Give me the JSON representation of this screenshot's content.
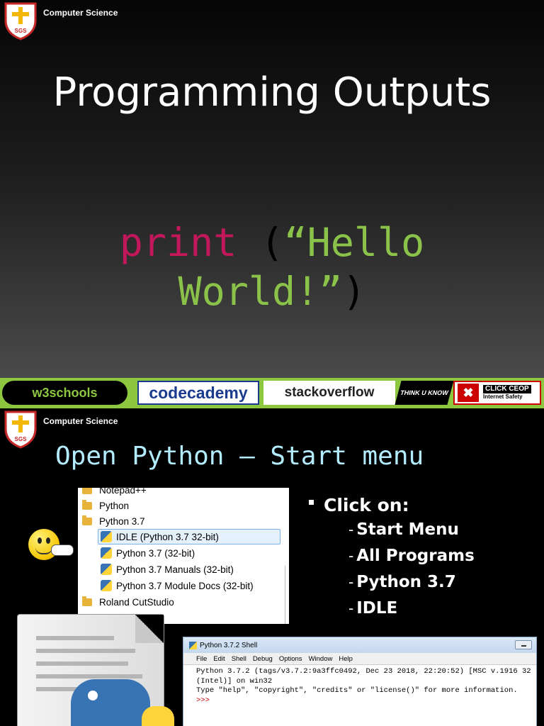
{
  "slide1": {
    "brand": "Computer Science",
    "logo_text": "SGS",
    "title": "Programming Outputs",
    "code": {
      "keyword": "print",
      "open_paren": " (",
      "string_line1": "“Hello",
      "string_line2": "World!”",
      "close_paren": ")"
    },
    "banner": {
      "w3schools": "w3schools",
      "codecademy": "codecademy",
      "stackoverflow": "stackoverflow",
      "thinkuknow": "THINK U KNOW",
      "ceop_line1": "CLICK CEOP",
      "ceop_line2": "Internet Safety"
    }
  },
  "slide2": {
    "brand": "Computer Science",
    "logo_text": "SGS",
    "title": "Open Python – Start menu",
    "start_menu": {
      "items": [
        "Notepad++",
        "Python",
        "Python 3.7",
        "IDLE (Python 3.7 32-bit)",
        "Python 3.7 (32-bit)",
        "Python 3.7 Manuals (32-bit)",
        "Python 3.7 Module Docs (32-bit)",
        "Roland CutStudio"
      ],
      "selected": "IDLE (Python 3.7 32-bit)"
    },
    "bullet": "Click on:",
    "steps": [
      "Start Menu",
      "All Programs",
      "Python 3.7",
      "IDLE"
    ],
    "step_prefix": "-",
    "shell": {
      "title": "Python 3.7.2 Shell",
      "menu": [
        "File",
        "Edit",
        "Shell",
        "Debug",
        "Options",
        "Window",
        "Help"
      ],
      "lines": [
        "Python 3.7.2 (tags/v3.7.2:9a3ffc0492, Dec 23 2018, 22:20:52) [MSC v.1916 32",
        "(Intel)] on win32",
        "Type \"help\", \"copyright\", \"credits\" or \"license()\" for more information."
      ],
      "prompt": ">>>"
    }
  },
  "colors": {
    "keyword": "#c2185b",
    "string": "#8bc34a",
    "title2": "#b3ecff",
    "banner": "#8dc63f"
  }
}
